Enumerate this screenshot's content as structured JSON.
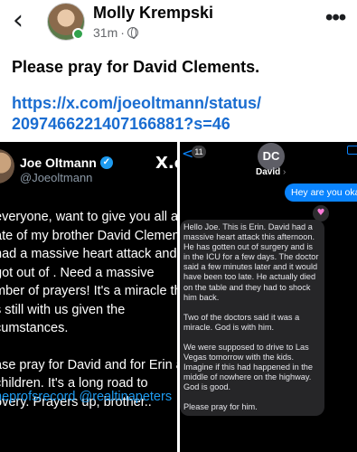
{
  "header": {
    "back_icon": "chevron-left-icon",
    "author_name": "Molly Krempski",
    "timestamp": "31m",
    "separator": "·",
    "privacy_icon": "globe-icon",
    "more_icon": "more-horizontal-icon"
  },
  "post": {
    "text": "Please pray for David Clements.",
    "link_line1": "https://x.com/joeoltmann/status/",
    "link_line2": "2097466221407166881?s=46"
  },
  "tweet": {
    "name": "Joe Oltmann",
    "verified_mark": "✓",
    "handle": "@Joeoltmann",
    "platform_logo": "X.co",
    "lines": [
      "everyone, want to give you all an",
      "ate of my brother David Clements",
      "had a massive heart attack and",
      "got out of . Need a massive",
      "mber of prayers! It's a miracle th",
      "s still with us given the",
      "cumstances."
    ],
    "lines2": [
      "ase pray for David and for Erin a",
      "children. It's a long road to",
      "overy. Prayers up, brother.."
    ],
    "tags": "neprofsrecord @realtinapeters"
  },
  "messages": {
    "back_glyph": "<",
    "unread_count": "11",
    "contact_initials": "DC",
    "contact_name": "David",
    "contact_chevron": "›",
    "outgoing": "Hey are you okay?",
    "reaction": "♥",
    "incoming_paragraphs": [
      "Hello Joe. This is Erin. David had a massive heart attack this afternoon. He has gotten out of surgery and is in the ICU for a few days. The doctor said a few minutes later and it would have been too late. He actually died on the table and they had to shock him back.",
      "Two of the doctors said it was a miracle. God is with him.",
      "We were supposed to drive to Las Vegas tomorrow with the kids. Imagine if this had happened in the middle of nowhere on the highway. God is good.",
      "Please pray for him."
    ]
  },
  "colors": {
    "link": "#1a6dd1",
    "online": "#31a24c",
    "imessage_blue": "#0a84ff",
    "x_verified": "#1d9bf0"
  }
}
